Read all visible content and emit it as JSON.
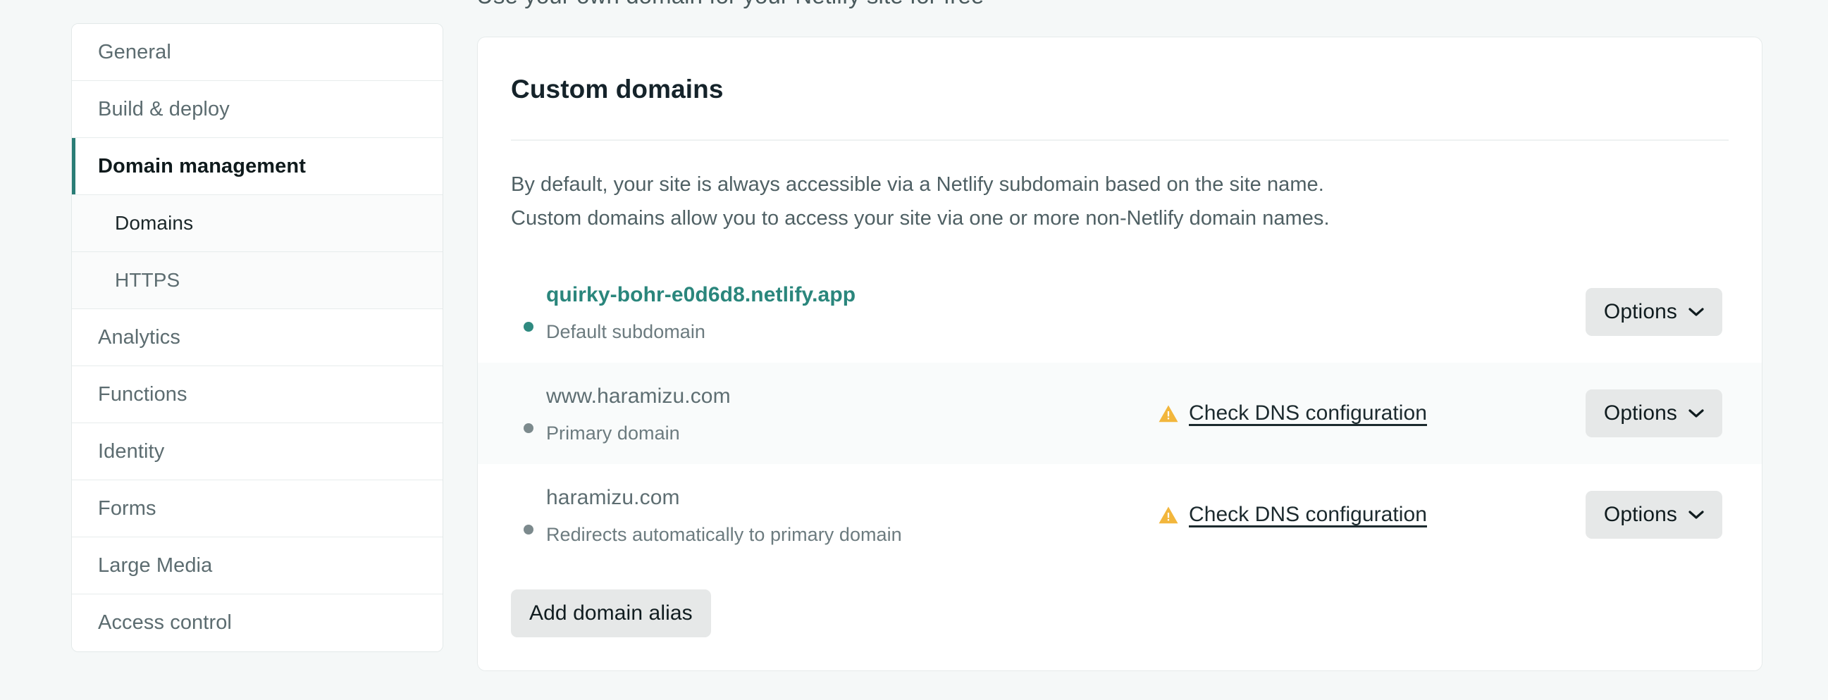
{
  "page": {
    "top_cut_heading": "Use your own domain for your Netlify site for free",
    "background_color": "#f5f8f8",
    "accent_color": "#2a7d76",
    "link_color": "#2a867c",
    "warning_color": "#f2b63c"
  },
  "sidebar": {
    "items": [
      {
        "label": "General",
        "type": "item",
        "state": "default"
      },
      {
        "label": "Build & deploy",
        "type": "item",
        "state": "default"
      },
      {
        "label": "Domain management",
        "type": "item",
        "state": "active"
      },
      {
        "label": "Domains",
        "type": "sub",
        "state": "sub-active"
      },
      {
        "label": "HTTPS",
        "type": "sub",
        "state": "default"
      },
      {
        "label": "Analytics",
        "type": "item",
        "state": "default"
      },
      {
        "label": "Functions",
        "type": "item",
        "state": "default"
      },
      {
        "label": "Identity",
        "type": "item",
        "state": "default"
      },
      {
        "label": "Forms",
        "type": "item",
        "state": "default"
      },
      {
        "label": "Large Media",
        "type": "item",
        "state": "default"
      },
      {
        "label": "Access control",
        "type": "item",
        "state": "default"
      }
    ]
  },
  "card": {
    "title": "Custom domains",
    "description_line1": "By default, your site is always accessible via a Netlify subdomain based on the site name.",
    "description_line2": "Custom domains allow you to access your site via one or more non-Netlify domain names.",
    "options_label": "Options",
    "add_alias_label": "Add domain alias",
    "rows": [
      {
        "domain": "quirky-bohr-e0d6d8.netlify.app",
        "subtitle": "Default subdomain",
        "is_link": true,
        "bullet": "teal",
        "status": "",
        "has_warning": false,
        "striped": false
      },
      {
        "domain": "www.haramizu.com",
        "subtitle": "Primary domain",
        "is_link": false,
        "bullet": "gray",
        "status": "Check DNS configuration",
        "has_warning": true,
        "striped": true
      },
      {
        "domain": "haramizu.com",
        "subtitle": "Redirects automatically to primary domain",
        "is_link": false,
        "bullet": "gray",
        "status": "Check DNS configuration",
        "has_warning": true,
        "striped": false
      }
    ]
  }
}
